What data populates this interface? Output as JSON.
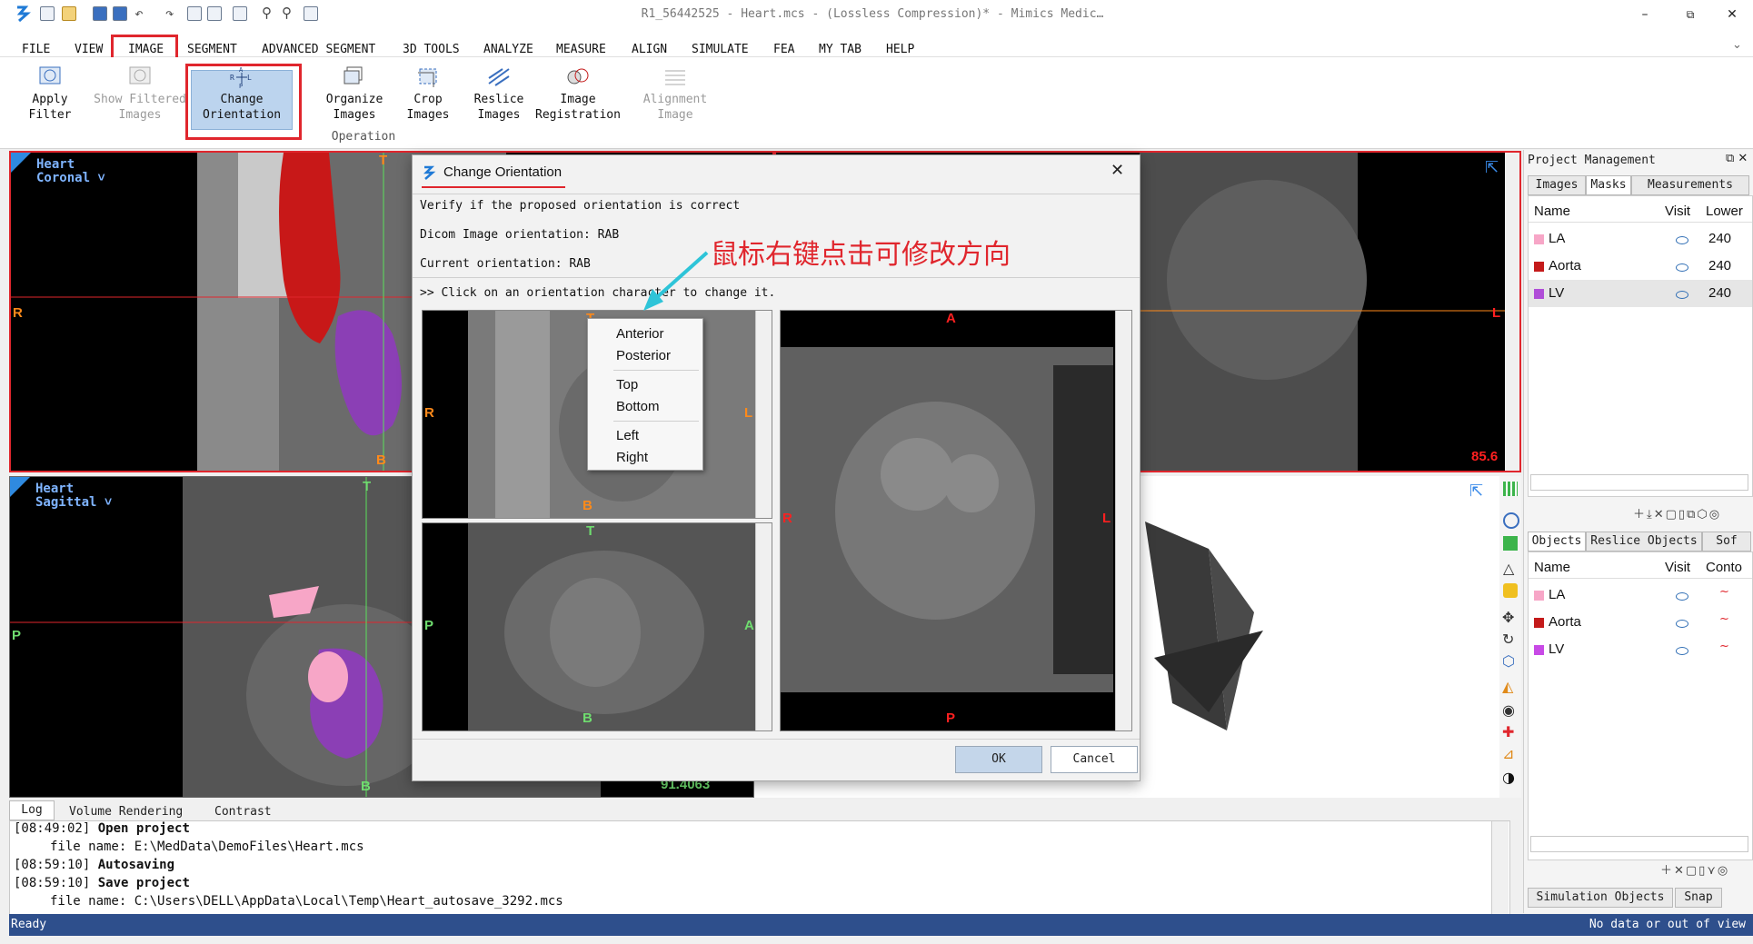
{
  "window": {
    "title": "R1_56442525 - Heart.mcs -  (Lossless Compression)* - Mimics Medic…",
    "controls": {
      "minimize": "–",
      "restore": "⧉",
      "close": "✕"
    }
  },
  "menu": {
    "items": [
      "FILE",
      "VIEW",
      "IMAGE",
      "SEGMENT",
      "ADVANCED SEGMENT",
      "3D TOOLS",
      "ANALYZE",
      "MEASURE",
      "ALIGN",
      "SIMULATE",
      "FEA",
      "MY TAB",
      "HELP"
    ],
    "active": "IMAGE"
  },
  "ribbon": {
    "buttons": [
      {
        "label1": "Apply",
        "label2": "Filter",
        "icon": "filter-icon"
      },
      {
        "label1": "Show Filtered",
        "label2": "Images",
        "icon": "filtered-images-icon",
        "disabled": true
      },
      {
        "label1": "Change",
        "label2": "Orientation",
        "icon": "orientation-icon",
        "selected": true
      },
      {
        "label1": "Organize",
        "label2": "Images",
        "icon": "organize-icon"
      },
      {
        "label1": "Crop",
        "label2": "Images",
        "icon": "crop-icon"
      },
      {
        "label1": "Reslice",
        "label2": "Images",
        "icon": "reslice-icon"
      },
      {
        "label1": "Image",
        "label2": "Registration",
        "icon": "registration-icon"
      },
      {
        "label1": "Alignment",
        "label2": "Image",
        "icon": "alignment-icon",
        "disabled": true
      }
    ],
    "group_label": "Operation"
  },
  "viewports": {
    "coronal": {
      "label1": "Heart",
      "label2": "Coronal ˅",
      "top": "T",
      "bottom": "B",
      "left": "R",
      "value": ""
    },
    "axial": {
      "right": "L",
      "value": "85.6"
    },
    "sagittal": {
      "label1": "Heart",
      "label2": "Sagittal ˅",
      "top": "T",
      "bottom": "B",
      "left": "P",
      "value": "91.4063"
    }
  },
  "project_panel": {
    "title": "Project Management",
    "tabs": [
      "Images",
      "Masks",
      "Measurements"
    ],
    "active_tab": "Masks",
    "columns": [
      "Name",
      "Visit",
      "Lower"
    ],
    "masks": [
      {
        "name": "LA",
        "color": "#f7a6c7",
        "lower": "240"
      },
      {
        "name": "Aorta",
        "color": "#c41a1a",
        "lower": "240"
      },
      {
        "name": "LV",
        "color": "#b04ed8",
        "lower": "240"
      }
    ],
    "objects_tabs": [
      "Objects",
      "Reslice Objects",
      "Sof"
    ],
    "objects_columns": [
      "Name",
      "Visit",
      "Conto"
    ],
    "objects": [
      {
        "name": "LA",
        "color": "#f7a6c7"
      },
      {
        "name": "Aorta",
        "color": "#c41a1a"
      },
      {
        "name": "LV",
        "color": "#c84ae6"
      }
    ],
    "bottom_tabs": [
      "Simulation Objects",
      "Snap"
    ]
  },
  "bottom_tabs": [
    "Log",
    "Volume Rendering",
    "Contrast"
  ],
  "log": [
    {
      "time": "[08:49:02]",
      "msg": "Open project",
      "detail": "file name: E:\\MedData\\DemoFiles\\Heart.mcs"
    },
    {
      "time": "[08:59:10]",
      "msg": "Autosaving",
      "detail": ""
    },
    {
      "time": "[08:59:10]",
      "msg": "Save project",
      "detail": "file name: C:\\Users\\DELL\\AppData\\Local\\Temp\\Heart_autosave_3292.mcs"
    }
  ],
  "status": {
    "left": "Ready",
    "right": "No data or out of view"
  },
  "dialog": {
    "title": "Change Orientation",
    "line1": "Verify if the proposed orientation is correct",
    "line2": "Dicom Image orientation: RAB",
    "line3": "Current orientation: RAB",
    "hint": ">> Click on an orientation character to change it.",
    "coronal": {
      "top": "T",
      "bottom": "B",
      "left": "R",
      "right": "L"
    },
    "sagittal": {
      "top": "T",
      "bottom": "B",
      "left": "P",
      "right": "A"
    },
    "axial": {
      "top": "A",
      "bottom": "P",
      "left": "R",
      "right": "L"
    },
    "ok": "OK",
    "cancel": "Cancel",
    "context_menu": [
      "Anterior",
      "Posterior",
      "Top",
      "Bottom",
      "Left",
      "Right"
    ]
  },
  "annotation": "鼠标右键点击可修改方向"
}
